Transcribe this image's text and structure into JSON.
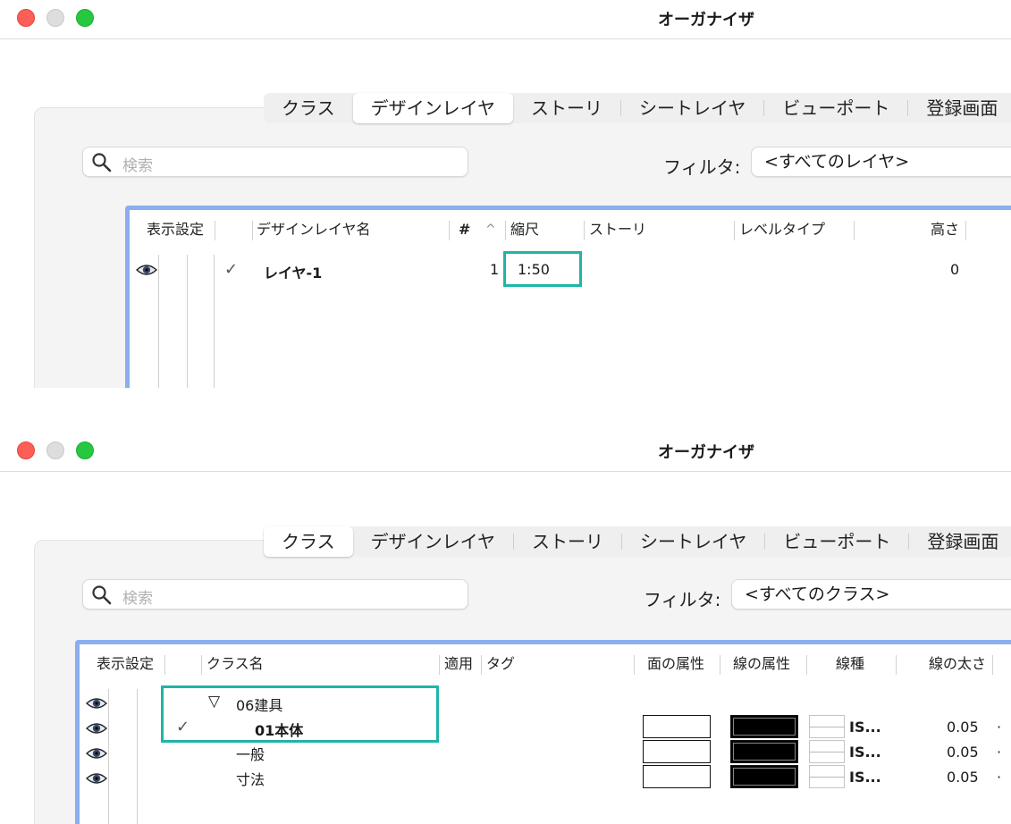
{
  "w1": {
    "title": "オーガナイザ",
    "tabs": [
      "クラス",
      "デザインレイヤ",
      "ストーリ",
      "シートレイヤ",
      "ビューポート",
      "登録画面"
    ],
    "selected_tab": 1,
    "search_placeholder": "検索",
    "filter_label": "フィルタ:",
    "filter_value": "<すべてのレイヤ>",
    "columns": {
      "visibility": "表示設定",
      "name": "デザインレイヤ名",
      "number": "#",
      "sort_indicator": "^",
      "scale": "縮尺",
      "story": "ストーリ",
      "level_type": "レベルタイプ",
      "height": "高さ"
    },
    "rows": [
      {
        "check": "✓",
        "name": "レイヤ-1",
        "number": "1",
        "scale": "1:50",
        "height": "0"
      }
    ]
  },
  "w2": {
    "title": "オーガナイザ",
    "tabs": [
      "クラス",
      "デザインレイヤ",
      "ストーリ",
      "シートレイヤ",
      "ビューポート",
      "登録画面"
    ],
    "selected_tab": 0,
    "search_placeholder": "検索",
    "filter_label": "フィルタ:",
    "filter_value": "<すべてのクラス>",
    "columns": {
      "visibility": "表示設定",
      "name": "クラス名",
      "apply": "適用",
      "tag": "タグ",
      "fill": "面の属性",
      "pen": "線の属性",
      "line_type": "線種",
      "line_weight": "線の太さ"
    },
    "rows": [
      {
        "toggle": "▽",
        "name": "06建具"
      },
      {
        "check": "✓",
        "name": "01本体",
        "line_type": "IS...",
        "line_weight": "0.05",
        "more": "·"
      },
      {
        "name": "一般",
        "line_type": "IS...",
        "line_weight": "0.05",
        "more": "·"
      },
      {
        "name": "寸法",
        "line_type": "IS...",
        "line_weight": "0.05",
        "more": "·"
      }
    ]
  },
  "colors": {
    "highlight": "#1fb5a8",
    "table_focus": "#8aaef0",
    "close": "#fd5f57",
    "zoom": "#27c840"
  },
  "icons": [
    "search-icon",
    "eye-icon",
    "check-icon",
    "disclosure-triangle-icon"
  ]
}
